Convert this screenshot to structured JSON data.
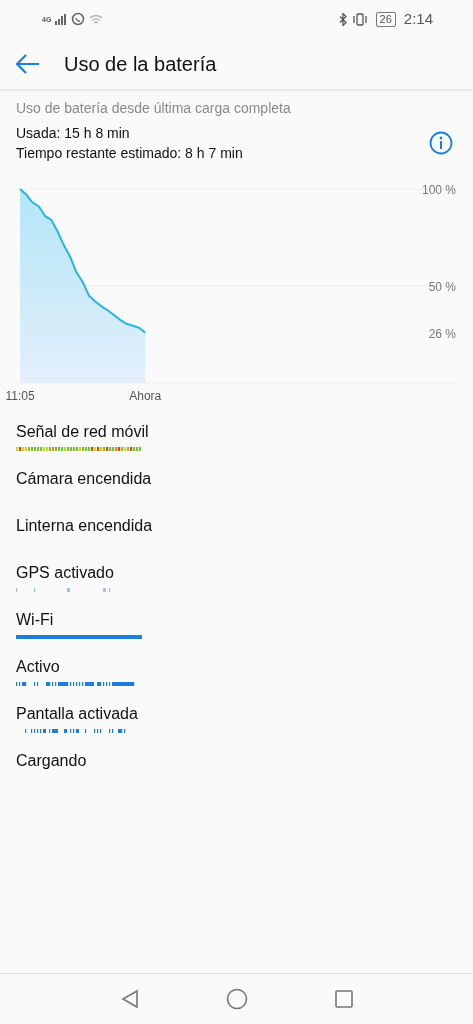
{
  "status_bar": {
    "network": "4G",
    "battery": "26",
    "time": "2:14"
  },
  "header": {
    "title": "Uso de la batería"
  },
  "summary": {
    "caption": "Uso de batería desde última carga completa",
    "used": "Usada: 15 h 8 min",
    "remaining": "Tiempo restante estimado: 8 h 7 min"
  },
  "chart_data": {
    "type": "area",
    "categories": [
      "11:05",
      null,
      null,
      null,
      null,
      null,
      null,
      null,
      null,
      null,
      null,
      null,
      null,
      null,
      null,
      null,
      null,
      null,
      null,
      null,
      "Ahora",
      null,
      null,
      null,
      null,
      null,
      null,
      null,
      null,
      null,
      null,
      null,
      null,
      null,
      null,
      null,
      null,
      null,
      null,
      null,
      null,
      null,
      null,
      null,
      null,
      null,
      null,
      null,
      null,
      null,
      null,
      null,
      null,
      null,
      null,
      null,
      null,
      null,
      null,
      null,
      null,
      null,
      null,
      null,
      null,
      null,
      null,
      null,
      null,
      null
    ],
    "series": [
      {
        "color": "#29b6e0",
        "values": [
          100,
          97,
          93,
          91,
          86,
          84,
          78,
          71,
          65,
          57,
          52,
          45,
          42,
          39.5,
          37.5,
          35,
          32.5,
          30.5,
          29.5,
          28.5,
          26,
          null,
          null,
          null,
          null,
          null,
          null,
          null,
          null,
          null,
          null,
          null,
          null,
          null,
          null,
          null,
          null,
          null,
          null,
          null,
          null,
          null,
          null,
          null,
          null,
          null,
          null,
          null,
          null,
          null,
          null,
          null,
          null,
          null,
          null,
          null,
          null,
          null,
          null,
          null,
          null,
          null,
          null,
          null,
          null,
          null,
          null,
          null,
          null,
          null
        ]
      }
    ],
    "ylim": [
      0,
      100
    ],
    "yticks": [
      {
        "value": 100,
        "label": "100 %"
      },
      {
        "value": 50,
        "label": "50 %"
      },
      {
        "value": 26,
        "label": "26 %"
      }
    ]
  },
  "timelines": [
    {
      "label": "Señal de red móvil",
      "kind": "signal"
    },
    {
      "label": "Cámara encendida",
      "kind": "none"
    },
    {
      "label": "Linterna encendida",
      "kind": "none"
    },
    {
      "label": "GPS activado",
      "kind": "sparse"
    },
    {
      "label": "Wi-Fi",
      "kind": "full"
    },
    {
      "label": "Activo",
      "kind": "dense"
    },
    {
      "label": "Pantalla activada",
      "kind": "segments"
    },
    {
      "label": "Cargando",
      "kind": "none"
    }
  ]
}
